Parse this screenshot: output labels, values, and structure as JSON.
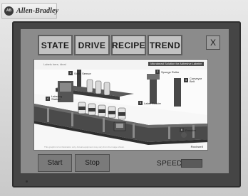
{
  "device": {
    "brand_logo_text": "AB",
    "brand_name": "Allen-Bradley"
  },
  "nav": {
    "buttons": [
      {
        "label": "STATE"
      },
      {
        "label": "DRIVE"
      },
      {
        "label": "RECIPE"
      },
      {
        "label": "TREND"
      }
    ],
    "close_label": "X"
  },
  "panel": {
    "title_left": "Labels here, ideal",
    "title_right": "Microbead Solution for Adhesive Labeler",
    "labels": {
      "static_sensor": "Static Sensor",
      "sponge_roller": "Sponge Roller",
      "conveyor_belt": "Conveyor Belt",
      "labeling_station": "Labeling Station",
      "label_reader": "Label Reader",
      "encoder": "Encoder"
    },
    "badges": [
      "1",
      "2",
      "3",
      "4",
      "5",
      "6"
    ],
    "footnote": "This graphic is for illustration only. Actual equipment may vary from the image shown.",
    "logo": "Rockwell"
  },
  "controls": {
    "start_label": "Start",
    "stop_label": "Stop",
    "speed_label": "SPEED",
    "speed_value": ""
  },
  "colors": {
    "screen_bg": "#8b8b8b",
    "button_face": "#c2c2c2",
    "control_button": "#7a7a7a",
    "speed_field": "#5a5a5a"
  }
}
